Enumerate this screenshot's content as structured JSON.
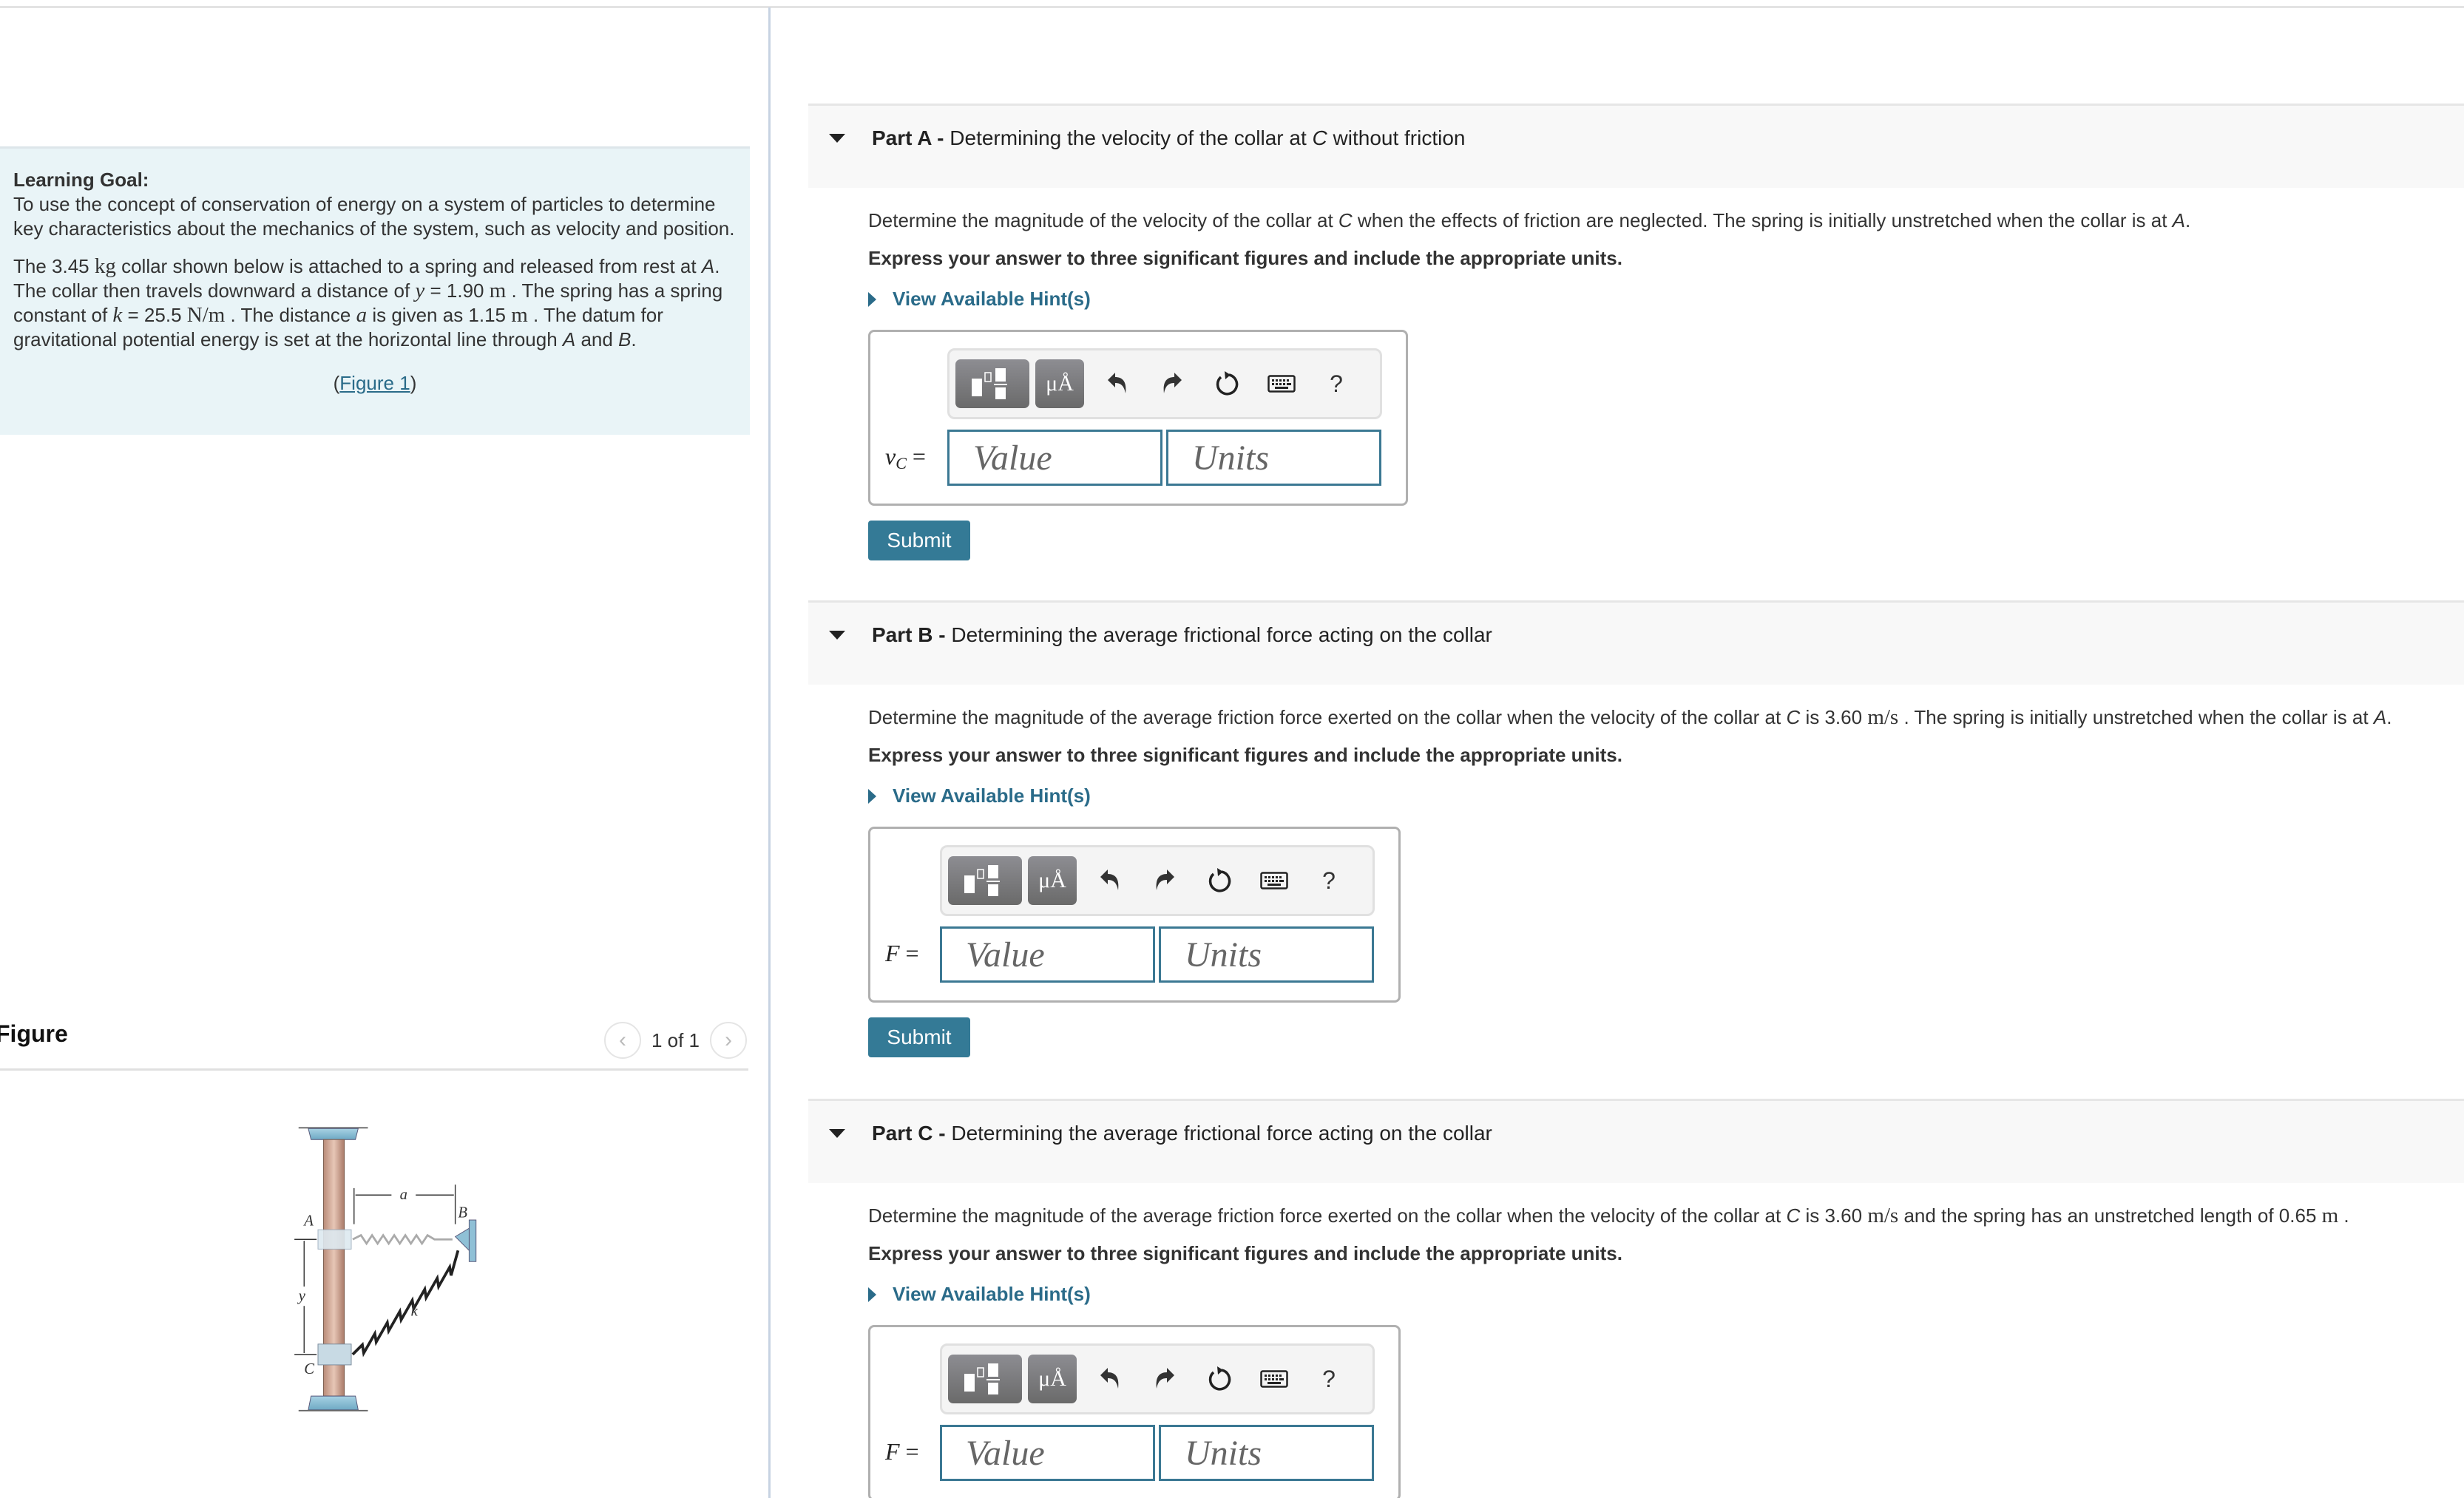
{
  "intro": {
    "goal_title": "Learning Goal:",
    "goal_text": "To use the concept of conservation of energy on a system of particles to determine key characteristics about the mechanics of the system, such as velocity and position.",
    "problem": {
      "s1": "The 3.45 ",
      "mass_unit": "kg",
      "s2": " collar shown below is attached to a spring and released from rest at ",
      "pt_A": "A",
      "s3": ". The collar then travels downward a distance of ",
      "var_y": "y",
      "s4": " = 1.90 ",
      "unit_m1": "m",
      "s5": " . The spring has a spring constant of ",
      "var_k": "k",
      "s6": " = 25.5 ",
      "unit_Nm": "N/m",
      "s7": " . The distance ",
      "var_a": "a",
      "s8": " is given as 1.15 ",
      "unit_m2": "m",
      "s9": " . The datum for gravitational potential energy is set at the horizontal line through ",
      "pt_A2": "A",
      "s10": " and ",
      "pt_B": "B",
      "s11": "."
    },
    "figure_link_open": "(",
    "figure_link": "Figure 1",
    "figure_link_close": ")"
  },
  "figure": {
    "title": "Figure",
    "pager_count": "1 of 1",
    "prev_icon": "‹",
    "next_icon": "›",
    "labels": {
      "a": "a",
      "A": "A",
      "B": "B",
      "C": "C",
      "y": "y",
      "k": "k"
    }
  },
  "parts": [
    {
      "label": "Part A -",
      "title_pre": " Determining the velocity of the collar at ",
      "title_it": "C",
      "title_post": " without friction",
      "prompt": {
        "p1": "Determine the magnitude of the velocity of the collar at ",
        "c": "C",
        "p2": " when the effects of friction are neglected. The spring is initially unstretched when the collar is at ",
        "a": "A",
        "p3": "."
      },
      "instruction": "Express your answer to three significant figures and include the appropriate units.",
      "hints": "View Available Hint(s)",
      "eq_var": "v",
      "eq_sub": "C",
      "eq_sign": " =",
      "value_placeholder": "Value",
      "units_placeholder": "Units",
      "submit": "Submit"
    },
    {
      "label": "Part B -",
      "title_pre": " Determining the average frictional force acting on the collar",
      "prompt": {
        "p1": "Determine the magnitude of the average friction force exerted on the collar when the velocity of the collar at ",
        "c": "C",
        "p2": " is 3.60 ",
        "unit": "m/s",
        "p3": " . The spring is initially unstretched when the collar is at ",
        "a": "A",
        "p4": "."
      },
      "instruction": "Express your answer to three significant figures and include the appropriate units.",
      "hints": "View Available Hint(s)",
      "eq_var": "F",
      "eq_sign": " =",
      "value_placeholder": "Value",
      "units_placeholder": "Units",
      "submit": "Submit"
    },
    {
      "label": "Part C -",
      "title_pre": " Determining the average frictional force acting on the collar",
      "prompt": {
        "p1": "Determine the magnitude of the average friction force exerted on the collar when the velocity of the collar at ",
        "c": "C",
        "p2": " is 3.60 ",
        "unit": "m/s",
        "p3": " and the spring has an unstretched length of 0.65 ",
        "unit2": "m",
        "p4": " ."
      },
      "instruction": "Express your answer to three significant figures and include the appropriate units.",
      "hints": "View Available Hint(s)",
      "eq_var": "F",
      "eq_sign": " =",
      "value_placeholder": "Value",
      "units_placeholder": "Units"
    }
  ],
  "toolbar": {
    "units_label": "μÅ",
    "help_label": "?"
  },
  "colors": {
    "accent": "#347a96",
    "link": "#2a6b89",
    "intro_bg": "#e9f4f7",
    "part_header_bg": "#f8f8f8"
  }
}
